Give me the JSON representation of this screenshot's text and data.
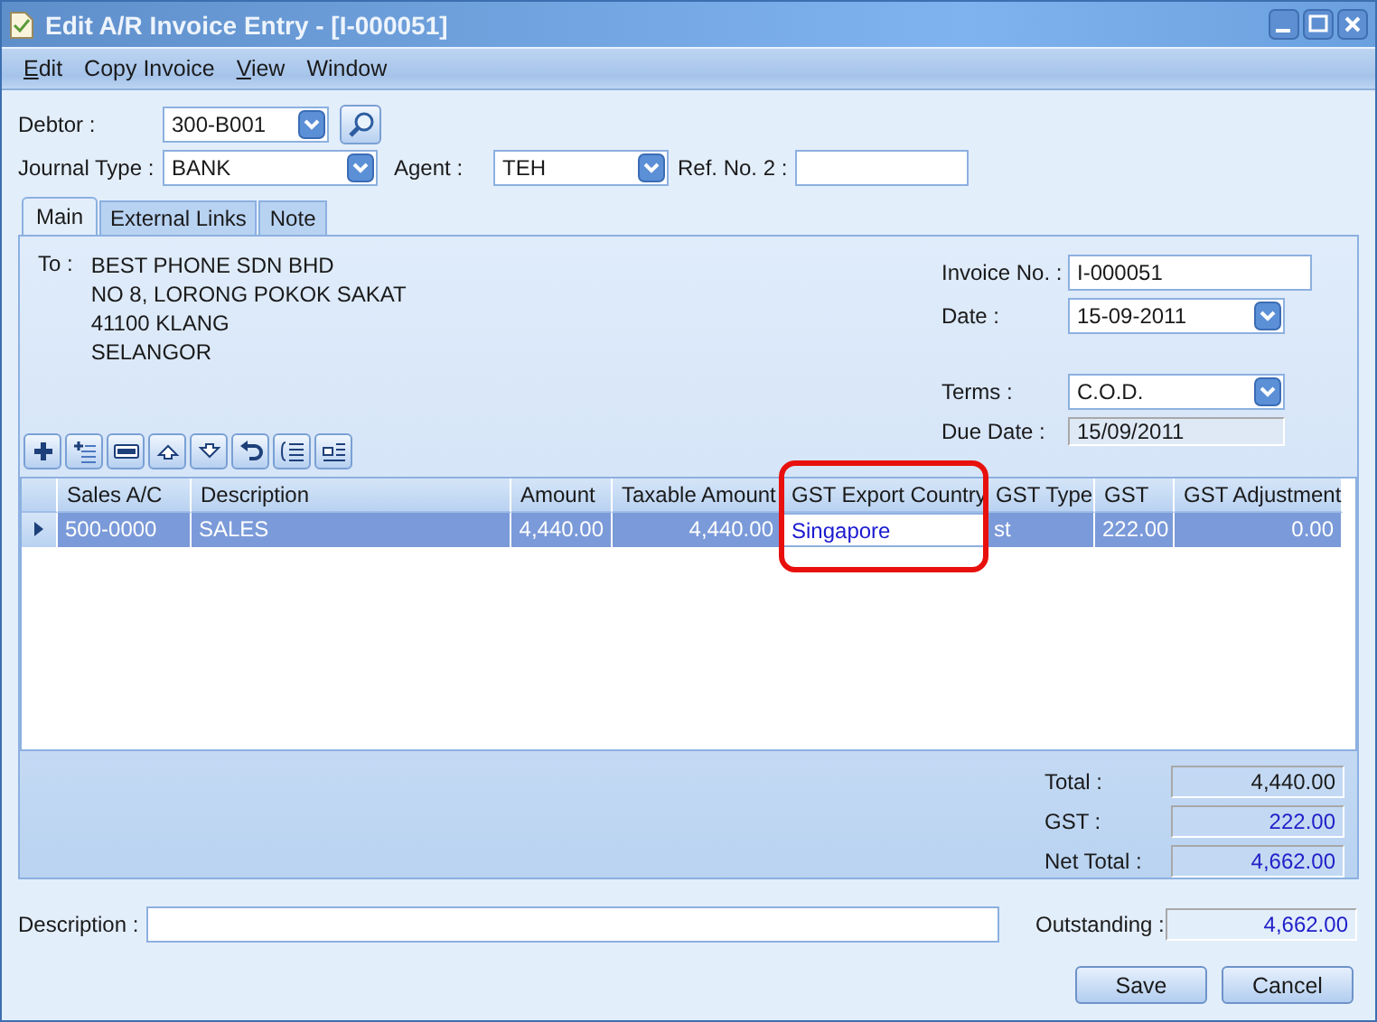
{
  "window": {
    "title": "Edit A/R Invoice Entry - [I-000051]"
  },
  "menu": [
    {
      "label": "Edit",
      "mnemonic_underlined": true
    },
    {
      "label": "Copy Invoice",
      "mnemonic_underlined": false
    },
    {
      "label": "View",
      "mnemonic_underlined": true
    },
    {
      "label": "Window",
      "mnemonic_underlined": false
    }
  ],
  "header": {
    "debtor": {
      "label": "Debtor :",
      "value": "300-B001"
    },
    "journal_type": {
      "label": "Journal Type :",
      "value": "BANK"
    },
    "agent": {
      "label": "Agent :",
      "value": "TEH"
    },
    "ref_no_2": {
      "label": "Ref. No. 2 :"
    }
  },
  "tabs": [
    {
      "label": "Main",
      "selected": true
    },
    {
      "label": "External Links",
      "selected": false
    },
    {
      "label": "Note",
      "selected": false
    }
  ],
  "to": {
    "label": "To :",
    "lines": [
      "BEST PHONE SDN BHD",
      "NO 8, LORONG POKOK SAKAT",
      "41100 KLANG",
      "SELANGOR"
    ]
  },
  "invoice": {
    "invoice_no": {
      "label": "Invoice No. :",
      "value": "I-000051"
    },
    "date": {
      "label": "Date :",
      "value": "15-09-2011"
    },
    "terms": {
      "label": "Terms :",
      "value": "C.O.D."
    },
    "due_date": {
      "label": "Due Date :",
      "value": "15/09/2011"
    }
  },
  "table": {
    "columns": [
      "Sales A/C",
      "Description",
      "Amount",
      "Taxable Amount",
      "GST Export Country",
      "GST Type",
      "GST",
      "GST Adjustment"
    ],
    "rows": [
      {
        "selected": true,
        "cells": [
          {
            "text": "500-0000",
            "editing": false
          },
          {
            "text": "SALES",
            "editing": false
          },
          {
            "text": "4,440.00",
            "editing": false
          },
          {
            "text": "4,440.00",
            "editing": false
          },
          {
            "text": "Singapore",
            "editing": true
          },
          {
            "text": "st",
            "editing": false
          },
          {
            "text": "222.00",
            "editing": false
          },
          {
            "text": "0.00",
            "editing": false
          }
        ]
      }
    ]
  },
  "totals": [
    {
      "label": "Total :",
      "value": "4,440.00"
    },
    {
      "label": "GST :",
      "value": "222.00"
    },
    {
      "label": "Net Total :",
      "value": "4,662.00"
    }
  ],
  "description": {
    "label": "Description :"
  },
  "outstanding": {
    "label": "Outstanding :",
    "value": "4,662.00"
  },
  "buttons": [
    "Save",
    "Cancel"
  ]
}
